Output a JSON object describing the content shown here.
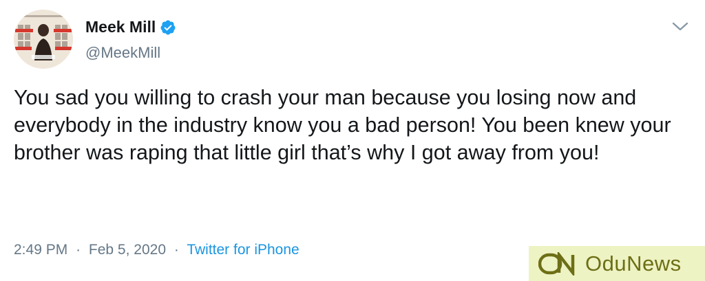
{
  "tweet": {
    "display_name": "Meek Mill",
    "handle": "@MeekMill",
    "text": "You sad you willing to crash your man because you losing now and everybody in the industry know you a bad person! You been knew your brother was raping that little girl that’s why I got away from you!",
    "time": "2:49 PM",
    "date": "Feb 5, 2020",
    "separator": "·",
    "source": "Twitter for iPhone",
    "verified": true
  },
  "watermark": {
    "text": "OduNews"
  },
  "colors": {
    "verified_badge": "#1da1f2",
    "source_link": "#1b95e0",
    "secondary_text": "#657786",
    "watermark_bg": "#eef3c4",
    "watermark_text": "#6d6f16"
  },
  "icons": {
    "verified": "verified-badge-icon",
    "caret": "chevron-down-icon",
    "watermark_logo": "odunews-logo"
  }
}
